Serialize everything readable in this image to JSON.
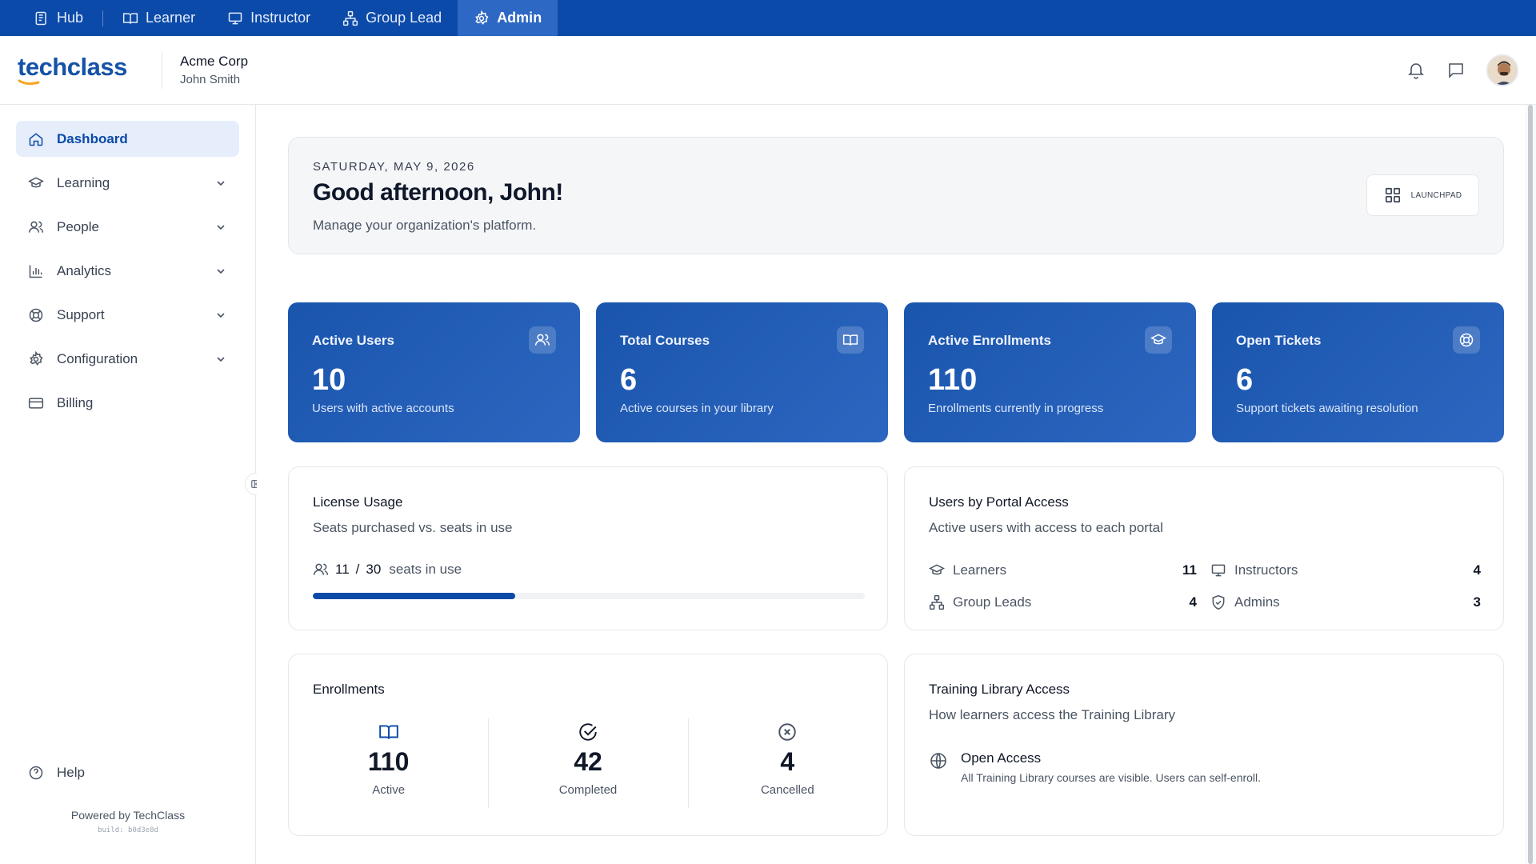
{
  "portal_tabs": [
    {
      "label": "Hub",
      "icon": "hub-icon"
    },
    {
      "label": "Learner",
      "icon": "book-open-icon"
    },
    {
      "label": "Instructor",
      "icon": "presentation-icon"
    },
    {
      "label": "Group Lead",
      "icon": "hierarchy-icon"
    },
    {
      "label": "Admin",
      "icon": "gear-icon",
      "active": true
    }
  ],
  "header": {
    "logo_text": "techclass",
    "org_name": "Acme Corp",
    "user_name": "John Smith"
  },
  "sidebar": {
    "items": [
      {
        "label": "Dashboard",
        "icon": "home-icon",
        "active": true
      },
      {
        "label": "Learning",
        "icon": "graduation-cap-icon",
        "expandable": true
      },
      {
        "label": "People",
        "icon": "users-icon",
        "expandable": true
      },
      {
        "label": "Analytics",
        "icon": "bar-chart-icon",
        "expandable": true
      },
      {
        "label": "Support",
        "icon": "lifebuoy-icon",
        "expandable": true
      },
      {
        "label": "Configuration",
        "icon": "gear-icon",
        "expandable": true
      },
      {
        "label": "Billing",
        "icon": "credit-card-icon"
      }
    ],
    "help_label": "Help",
    "powered_by": "Powered by TechClass",
    "build": "build: b0d3e8d"
  },
  "welcome": {
    "date": "SATURDAY, MAY 9, 2026",
    "greeting": "Good afternoon, John!",
    "subtitle": "Manage your organization's platform.",
    "launchpad_label": "LAUNCHPAD"
  },
  "stats": [
    {
      "title": "Active Users",
      "value": "10",
      "desc": "Users with active accounts",
      "icon": "users-icon"
    },
    {
      "title": "Total Courses",
      "value": "6",
      "desc": "Active courses in your library",
      "icon": "book-open-icon"
    },
    {
      "title": "Active Enrollments",
      "value": "110",
      "desc": "Enrollments currently in progress",
      "icon": "graduation-cap-icon"
    },
    {
      "title": "Open Tickets",
      "value": "6",
      "desc": "Support tickets awaiting resolution",
      "icon": "lifebuoy-icon"
    }
  ],
  "license": {
    "title": "License Usage",
    "subtitle": "Seats purchased vs. seats in use",
    "used": "11",
    "total": "30",
    "separator": "/",
    "suffix": "seats in use",
    "fraction": 0.3667
  },
  "portal_access": {
    "title": "Users by Portal Access",
    "subtitle": "Active users with access to each portal",
    "rows": [
      {
        "label": "Learners",
        "count": "11",
        "icon": "graduation-cap-icon"
      },
      {
        "label": "Instructors",
        "count": "4",
        "icon": "presentation-icon"
      },
      {
        "label": "Group Leads",
        "count": "4",
        "icon": "hierarchy-icon"
      },
      {
        "label": "Admins",
        "count": "3",
        "icon": "shield-check-icon"
      }
    ]
  },
  "enrollments": {
    "title": "Enrollments",
    "items": [
      {
        "value": "110",
        "label": "Active",
        "icon": "book-open-icon",
        "color": "#0b4aa8"
      },
      {
        "value": "42",
        "label": "Completed",
        "icon": "check-circle-icon",
        "color": "#111827"
      },
      {
        "value": "4",
        "label": "Cancelled",
        "icon": "x-circle-icon",
        "color": "#4b5563"
      }
    ]
  },
  "library_access": {
    "title": "Training Library Access",
    "subtitle": "How learners access the Training Library",
    "mode_title": "Open Access",
    "mode_desc": "All Training Library courses are visible. Users can self-enroll."
  },
  "colors": {
    "brand": "#0b4aa8",
    "portal_bar": "#0b4aa8",
    "active_tab": "#2d68c4",
    "stat_card": "#1a55ad"
  }
}
